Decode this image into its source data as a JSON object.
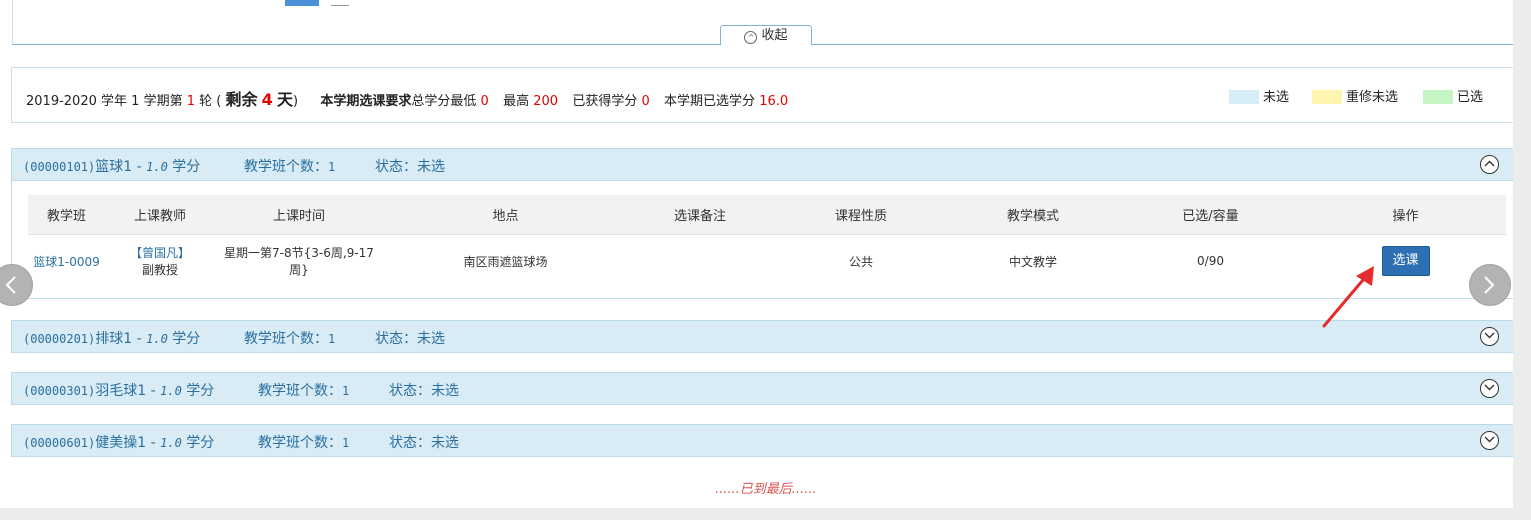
{
  "collapse_tab": {
    "label": "收起"
  },
  "info": {
    "year": "2019-2020",
    "year_suffix": "学年",
    "term": "1",
    "term_suffix": "学期第",
    "round": "1",
    "round_suffix": "轮 (",
    "remain_label": "剩余",
    "remain_days": "4",
    "remain_unit": "天",
    "close_paren": ")",
    "req_label": "本学期选课要求",
    "min_label": "总学分最低",
    "min_value": "0",
    "max_label": "最高",
    "max_value": "200",
    "earned_label": "已获得学分",
    "earned_value": "0",
    "selected_label": "本学期已选学分",
    "selected_value": "16.0"
  },
  "legend": [
    {
      "label": "未选",
      "color": "#d6ecf7"
    },
    {
      "label": "重修未选",
      "color": "#fdf4b0"
    },
    {
      "label": "已选",
      "color": "#c5f5c5"
    }
  ],
  "courses": [
    {
      "code": "(00000101)",
      "name": "篮球1",
      "dash": " - ",
      "credit": "1.0",
      "credit_unit": "学分",
      "count_label": "教学班个数：",
      "count": "1",
      "status_label": "状态：",
      "status": "未选"
    },
    {
      "code": "(00000201)",
      "name": "排球1",
      "dash": " - ",
      "credit": "1.0",
      "credit_unit": "学分",
      "count_label": "教学班个数：",
      "count": "1",
      "status_label": "状态：",
      "status": "未选"
    },
    {
      "code": "(00000301)",
      "name": "羽毛球1",
      "dash": " - ",
      "credit": "1.0",
      "credit_unit": "学分",
      "count_label": "教学班个数：",
      "count": "1",
      "status_label": "状态：",
      "status": "未选"
    },
    {
      "code": "(00000601)",
      "name": "健美操1",
      "dash": " - ",
      "credit": "1.0",
      "credit_unit": "学分",
      "count_label": "教学班个数：",
      "count": "1",
      "status_label": "状态：",
      "status": "未选"
    }
  ],
  "table": {
    "headers": [
      "教学班",
      "上课教师",
      "上课时间",
      "地点",
      "选课备注",
      "课程性质",
      "教学模式",
      "已选/容量",
      "操作"
    ],
    "row": {
      "class_id": "篮球1-0009",
      "teacher_name": "【曾国凡】",
      "teacher_title": "副教授",
      "time": "星期一第7-8节{3-6周,9-17周}",
      "place": "南区雨遮篮球场",
      "note": "",
      "nature": "公共",
      "mode": "中文教学",
      "capacity": "0/90",
      "action": "选课"
    }
  },
  "end_text": "......已到最后......"
}
